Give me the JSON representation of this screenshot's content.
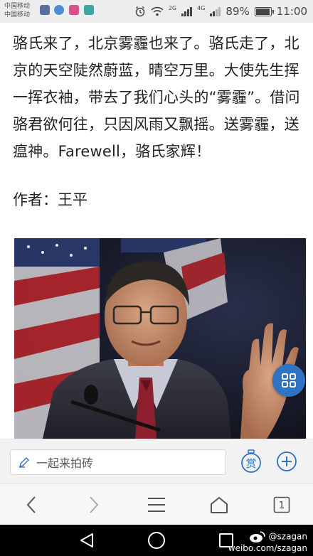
{
  "status_bar": {
    "carrier_line1": "中国移动",
    "carrier_line2": "中国移动",
    "network_label": "2G",
    "network_label2": "4G",
    "battery_percent": "89%",
    "battery_level": 0.89,
    "time": "11:00"
  },
  "article": {
    "paragraph": "骆氏来了，北京雾霾也来了。骆氏走了，北京的天空陡然蔚蓝，晴空万里。大使先生挥一挥衣袖，带去了我们心头的“雾霾”。借问骆君欲何往，只因风雨又飘摇。送雾霾，送瘟神。Farewell，骆氏家辉！",
    "author": "作者：王平"
  },
  "comment_bar": {
    "placeholder": "一起来拍砖",
    "reward_label": "赏"
  },
  "browser_nav": {
    "tab_count": "1"
  },
  "watermark": {
    "handle": "@szagan",
    "url": "weibo.com/szagan"
  },
  "colors": {
    "accent": "#2f74c4",
    "status_bg": "#ededed",
    "nav_bg": "#f7f7f7",
    "sysnav_bg": "#000000"
  }
}
